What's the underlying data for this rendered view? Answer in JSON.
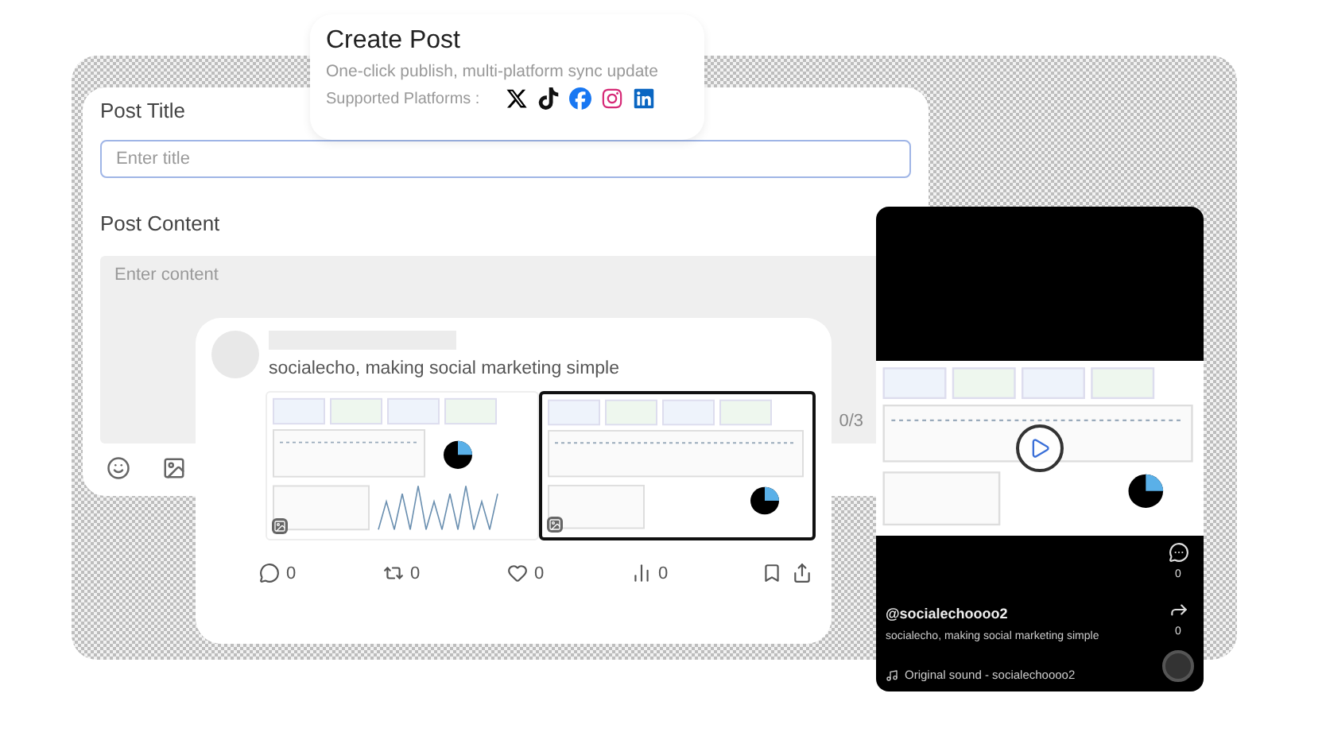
{
  "header": {
    "title": "Create Post",
    "subtitle": "One-click publish, multi-platform sync update",
    "platforms_label": "Supported Platforms :"
  },
  "form": {
    "title_label": "Post Title",
    "title_placeholder": "Enter title",
    "content_label": "Post Content",
    "content_placeholder": "Enter content",
    "counter": "0/3"
  },
  "tweet": {
    "text": "socialecho, making social marketing simple",
    "actions": [
      {
        "kind": "reply",
        "count": "0"
      },
      {
        "kind": "repost",
        "count": "0"
      },
      {
        "kind": "like",
        "count": "0"
      },
      {
        "kind": "views",
        "count": "0"
      }
    ]
  },
  "video": {
    "comments": "0",
    "shares": "0",
    "handle": "@socialechoooo2",
    "caption": "socialecho, making social marketing simple",
    "sound": "Original sound - socialechoooo2"
  }
}
